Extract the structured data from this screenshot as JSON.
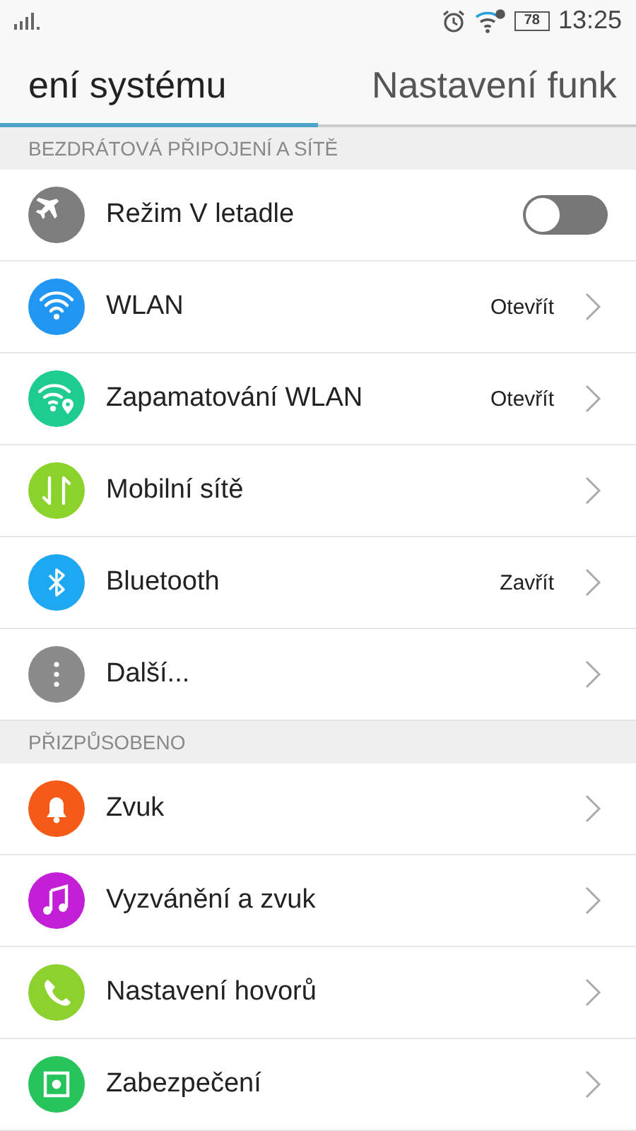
{
  "status_bar": {
    "battery": "78",
    "time": "13:25"
  },
  "tabs": [
    {
      "label": "ení systému",
      "selected": true
    },
    {
      "label": "Nastavení funk",
      "selected": false
    }
  ],
  "sections": [
    {
      "title": "BEZDRÁTOVÁ PŘIPOJENÍ A SÍTĚ",
      "items": [
        {
          "kind": "toggle",
          "label": "Režim V letadle",
          "on": false,
          "color": "#7d7d7d"
        },
        {
          "kind": "link",
          "label": "WLAN",
          "value": "Otevřít",
          "color": "#2196f3"
        },
        {
          "kind": "link",
          "label": "Zapamatování WLAN",
          "value": "Otevřít",
          "color": "#1fcc90"
        },
        {
          "kind": "link",
          "label": "Mobilní sítě",
          "color": "#8bd22c"
        },
        {
          "kind": "link",
          "label": "Bluetooth",
          "value": "Zavřít",
          "color": "#1ea8f2"
        },
        {
          "kind": "link",
          "label": "Další...",
          "color": "#8a8a8a"
        }
      ]
    },
    {
      "title": "PŘIZPŮSOBENO",
      "items": [
        {
          "kind": "link",
          "label": "Zvuk",
          "color": "#f45a18"
        },
        {
          "kind": "link",
          "label": "Vyzvánění a zvuk",
          "color": "#c31fd6"
        },
        {
          "kind": "link",
          "label": "Nastavení hovorů",
          "color": "#8cd12e"
        },
        {
          "kind": "link",
          "label": "Zabezpečení",
          "color": "#27c45c"
        }
      ]
    }
  ]
}
